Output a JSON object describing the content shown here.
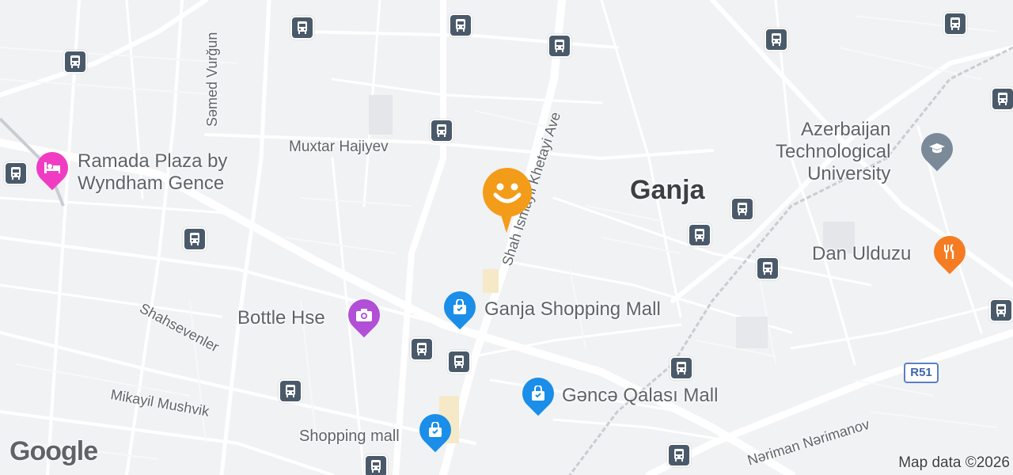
{
  "map": {
    "city_label": "Ganja",
    "places": [
      {
        "id": "ramada",
        "line1": "Ramada Plaza by",
        "line2": "Wyndham Gence",
        "icon": "hotel-icon",
        "color": "#f03cc3"
      },
      {
        "id": "bottle",
        "line1": "Bottle Hse",
        "icon": "camera-icon",
        "color": "#b14fd6"
      },
      {
        "id": "ganja-mall",
        "line1": "Ganja Shopping Mall",
        "icon": "shopping-bag-icon",
        "color": "#1a8ee8"
      },
      {
        "id": "qalasi-mall",
        "line1": "Gəncə Qalası Mall",
        "icon": "shopping-bag-icon",
        "color": "#1a8ee8"
      },
      {
        "id": "shopping-mall",
        "line1": "Shopping mall",
        "icon": "shopping-bag-icon",
        "color": "#1a8ee8"
      },
      {
        "id": "dan-ulduzu",
        "line1": "Dan Ulduzu",
        "icon": "restaurant-icon",
        "color": "#f57c22"
      },
      {
        "id": "atu",
        "line1": "Azerbaijan",
        "line2": "Technological",
        "line3": "University",
        "icon": "school-icon",
        "color": "#7a8a99"
      }
    ],
    "streets": {
      "semed": "Səmed Vurğun",
      "muxtar": "Muxtar Hajiyev",
      "shah": "Shah Ismayil Khetayi Ave",
      "shahsevenler": "Shahsevenler",
      "mikayil": "Mikayil Mushvik",
      "neriman": "Nəriman Nərimanov"
    },
    "road_shield": "R51",
    "current_location_icon": "smiley-location-icon",
    "bus_stop_icon": "bus-stop-icon"
  },
  "footer": {
    "logo": "Google",
    "attribution": "Map data ©2026"
  }
}
